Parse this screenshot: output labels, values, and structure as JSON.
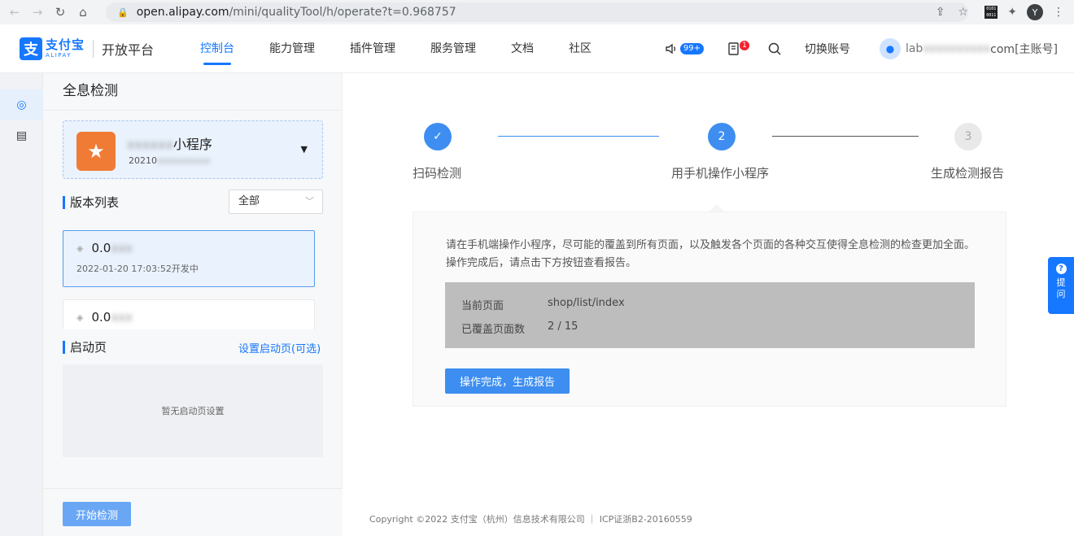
{
  "browser": {
    "url_host": "open.alipay.com",
    "url_path": "/mini/qualityTool/h/operate?t=0.968757",
    "profile_initial": "Y"
  },
  "header": {
    "logo_cn": "支付宝",
    "logo_en": "ALIPAY",
    "platform": "开放平台",
    "nav": [
      {
        "label": "控制台",
        "active": true
      },
      {
        "label": "能力管理",
        "active": false
      },
      {
        "label": "插件管理",
        "active": false
      },
      {
        "label": "服务管理",
        "active": false
      },
      {
        "label": "文档",
        "active": false
      },
      {
        "label": "社区",
        "active": false
      }
    ],
    "notice_badge": "99+",
    "message_badge": "1",
    "switch_account": "切换账号",
    "user_prefix": "lab",
    "user_suffix": "com[主账号]"
  },
  "left": {
    "title": "全息检测",
    "app_name_suffix": "小程序",
    "app_id_prefix": "20210",
    "version_section": "版本列表",
    "filter_value": "全部",
    "versions": [
      {
        "name": "0.0",
        "meta": "2022-01-20 17:03:52开发中",
        "active": true
      },
      {
        "name": "0.0",
        "meta": "",
        "active": false
      }
    ],
    "launch_section": "启动页",
    "launch_link": "设置启动页(可选)",
    "launch_empty": "暂无启动页设置",
    "start_button": "开始检测"
  },
  "steps": [
    {
      "index": "✓",
      "label": "扫码检测",
      "state": "done"
    },
    {
      "index": "2",
      "label": "用手机操作小程序",
      "state": "active"
    },
    {
      "index": "3",
      "label": "生成检测报告",
      "state": "todo"
    }
  ],
  "content": {
    "description": "请在手机端操作小程序，尽可能的覆盖到所有页面，以及触发各个页面的各种交互使得全息检测的检查更加全面。操作完成后，请点击下方按钮查看报告。",
    "current_page_label": "当前页面",
    "current_page_value": "shop/list/index",
    "covered_label": "已覆盖页面数",
    "covered_value": "2 / 15",
    "done_button": "操作完成，生成报告"
  },
  "footer": {
    "copyright": "Copyright ©2022 支付宝（杭州）信息技术有限公司 ｜ ICP证浙B2-20160559"
  },
  "help": {
    "label_1": "提",
    "label_2": "问"
  },
  "colors": {
    "brand": "#1677ff",
    "step": "#3d8ef0"
  }
}
